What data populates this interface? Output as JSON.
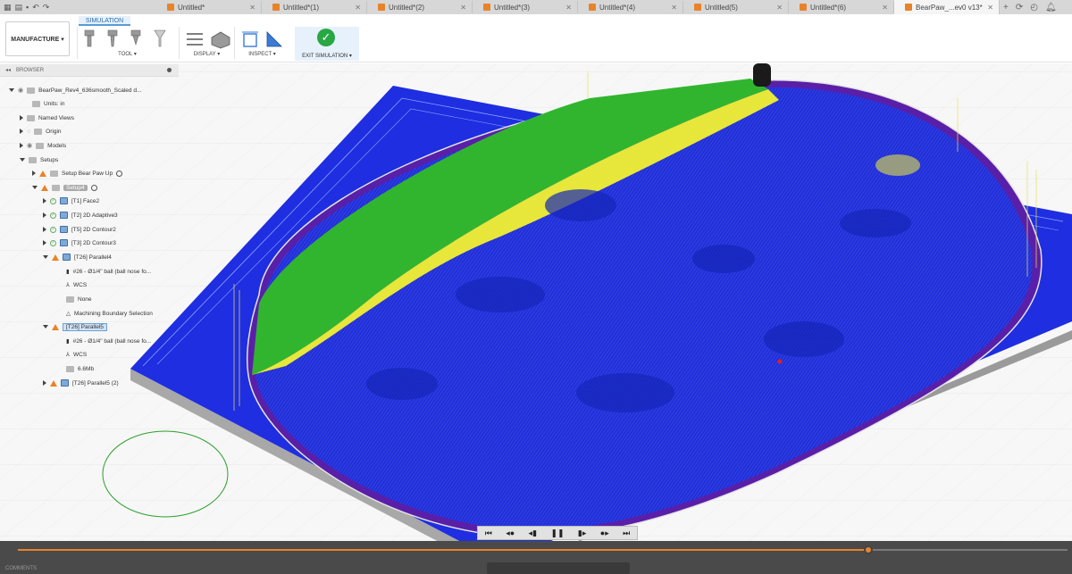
{
  "tabs": [
    {
      "label": "Untitled*"
    },
    {
      "label": "Untitled*(1)"
    },
    {
      "label": "Untitled*(2)"
    },
    {
      "label": "Untitled*(3)"
    },
    {
      "label": "Untitled*(4)"
    },
    {
      "label": "Untitled(5)"
    },
    {
      "label": "Untitled*(6)"
    },
    {
      "label": "BearPaw_...ev0 v13*"
    }
  ],
  "toolbar": {
    "mode_tab": "SIMULATION",
    "workspace": "MANUFACTURE ▾",
    "tool_label": "TOOL ▾",
    "display_label": "DISPLAY ▾",
    "inspect_label": "INSPECT ▾",
    "exit_label": "EXIT SIMULATION ▾"
  },
  "browser": {
    "title": "BROWSER",
    "items": [
      {
        "label": "BearPaw_Rev4_636smooth_Scaled d..."
      },
      {
        "label": "Units: in"
      },
      {
        "label": "Named Views"
      },
      {
        "label": "Origin"
      },
      {
        "label": "Models"
      },
      {
        "label": "Setups"
      },
      {
        "label": "Setup Bear Paw Up"
      },
      {
        "label": "Setup4"
      },
      {
        "label": "[T1] Face2"
      },
      {
        "label": "[T2] 2D Adaptive3"
      },
      {
        "label": "[T5] 2D Contour2"
      },
      {
        "label": "[T3] 2D Contour3"
      },
      {
        "label": "[T26] Parallel4"
      },
      {
        "label": "#26 - Ø1/4\" ball (ball nose fo..."
      },
      {
        "label": "WCS"
      },
      {
        "label": "None"
      },
      {
        "label": "Machining Boundary Selection"
      },
      {
        "label": "[T26] Parallel5"
      },
      {
        "label": "#26 - Ø1/4\" ball (ball nose fo..."
      },
      {
        "label": "WCS"
      },
      {
        "label": "6.6Mb"
      },
      {
        "label": "[T26] Parallel5 (2)"
      }
    ]
  },
  "comments_label": "COMMENTS",
  "playback": {
    "progress": 0.81
  },
  "colors": {
    "accent": "#e8832a",
    "stock": "#2aa82a",
    "toolpath": "#1f2fe0",
    "highlight": "#f0f020"
  }
}
